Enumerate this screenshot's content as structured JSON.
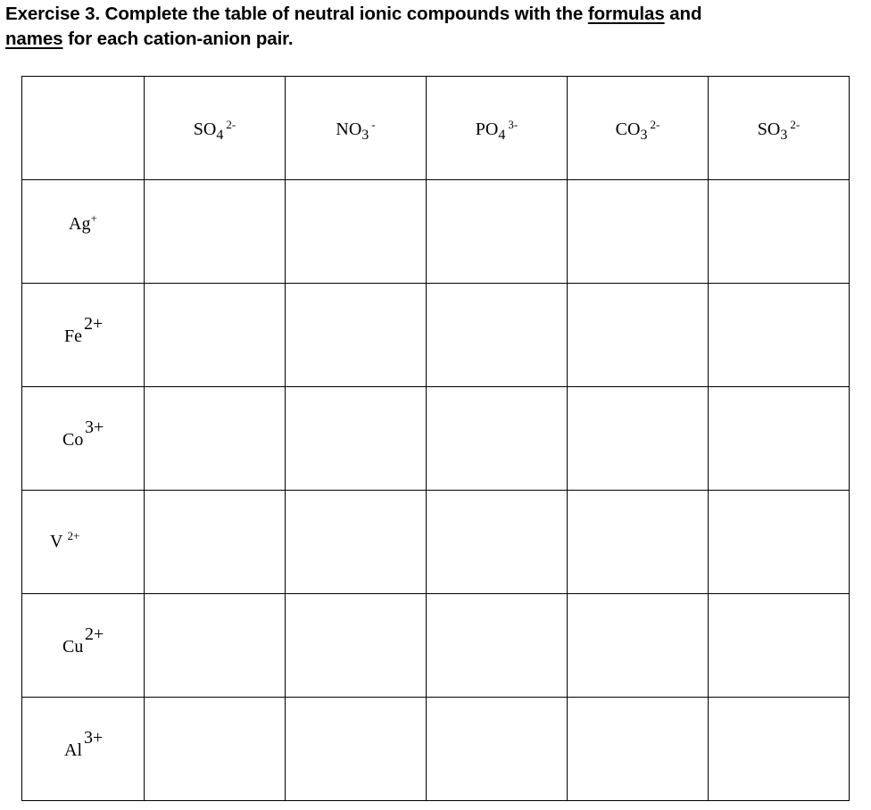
{
  "heading": {
    "prefix": "Exercise 3. Complete the table of neutral ionic compounds with the ",
    "underline1": "formulas",
    "middle": " and",
    "underline2": "names",
    "suffix": " for each cation-anion pair."
  },
  "table": {
    "corner": "",
    "anions": [
      {
        "base": "SO",
        "sub": "4",
        "charge": "2-"
      },
      {
        "base": "NO",
        "sub": "3",
        "charge": "-"
      },
      {
        "base": "PO",
        "sub": "4",
        "charge": "3-"
      },
      {
        "base": "CO",
        "sub": "3",
        "charge": "2-"
      },
      {
        "base": "SO",
        "sub": "3",
        "charge": "2-"
      }
    ],
    "cations": [
      {
        "symbol": "Ag",
        "charge": "+"
      },
      {
        "symbol": "Fe",
        "charge": "2+"
      },
      {
        "symbol": "Co",
        "charge": "3+"
      },
      {
        "symbol": "V",
        "charge": "2+"
      },
      {
        "symbol": "Cu",
        "charge": "2+"
      },
      {
        "symbol": "Al",
        "charge": "3+"
      }
    ]
  }
}
